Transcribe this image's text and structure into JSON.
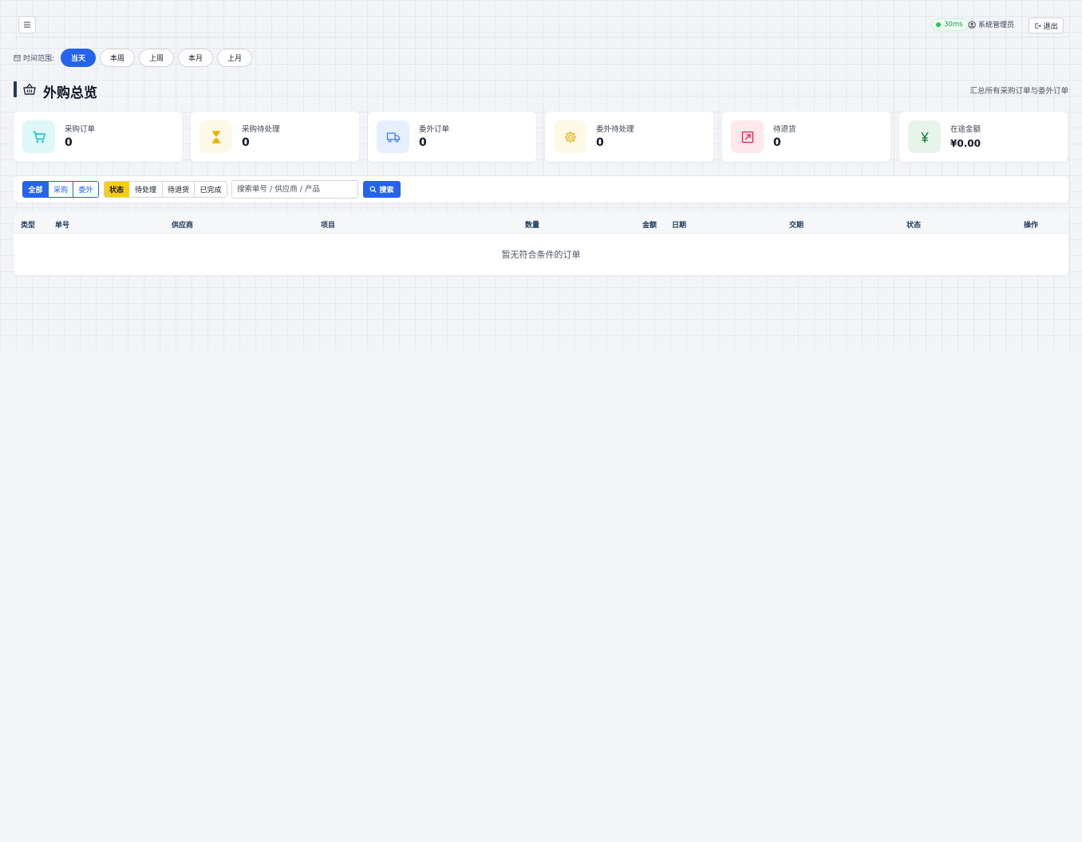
{
  "header": {
    "menu_icon": "hamburger-icon",
    "latency": "30ms",
    "latency_color": "#22c55e",
    "user_name": "系统管理员",
    "logout_label": "退出"
  },
  "time_range": {
    "label": "时间范围:",
    "options": [
      "当天",
      "本周",
      "上周",
      "本月",
      "上月"
    ],
    "selected": "当天"
  },
  "title": {
    "text": "外购总览",
    "subtitle": "汇总所有采购订单与委外订单"
  },
  "stats": [
    {
      "label": "采购订单",
      "value": "0",
      "icon": "cart-icon",
      "color": "#06b6d4"
    },
    {
      "label": "采购待处理",
      "value": "0",
      "icon": "hourglass-icon",
      "color": "#eab308"
    },
    {
      "label": "委外订单",
      "value": "0",
      "icon": "truck-icon",
      "color": "#3b82f6"
    },
    {
      "label": "委外待处理",
      "value": "0",
      "icon": "gear-icon",
      "color": "#eab308"
    },
    {
      "label": "待退货",
      "value": "0",
      "icon": "return-arrow-icon",
      "color": "#e11d48"
    },
    {
      "label": "在途金额",
      "value": "¥0.00",
      "icon": "yen-icon",
      "color": "#15803d"
    }
  ],
  "filters": {
    "type_options": [
      "全部",
      "采购",
      "委外"
    ],
    "type_selected": "全部",
    "status_options": [
      "状态",
      "待处理",
      "待退货",
      "已完成"
    ],
    "status_selected": "状态",
    "search_placeholder": "搜索单号 / 供应商 / 产品",
    "search_button": "搜索"
  },
  "table": {
    "columns": [
      "类型",
      "单号",
      "供应商",
      "项目",
      "数量",
      "金额",
      "日期",
      "交期",
      "状态",
      "操作"
    ],
    "empty_text": "暂无符合条件的订单"
  }
}
